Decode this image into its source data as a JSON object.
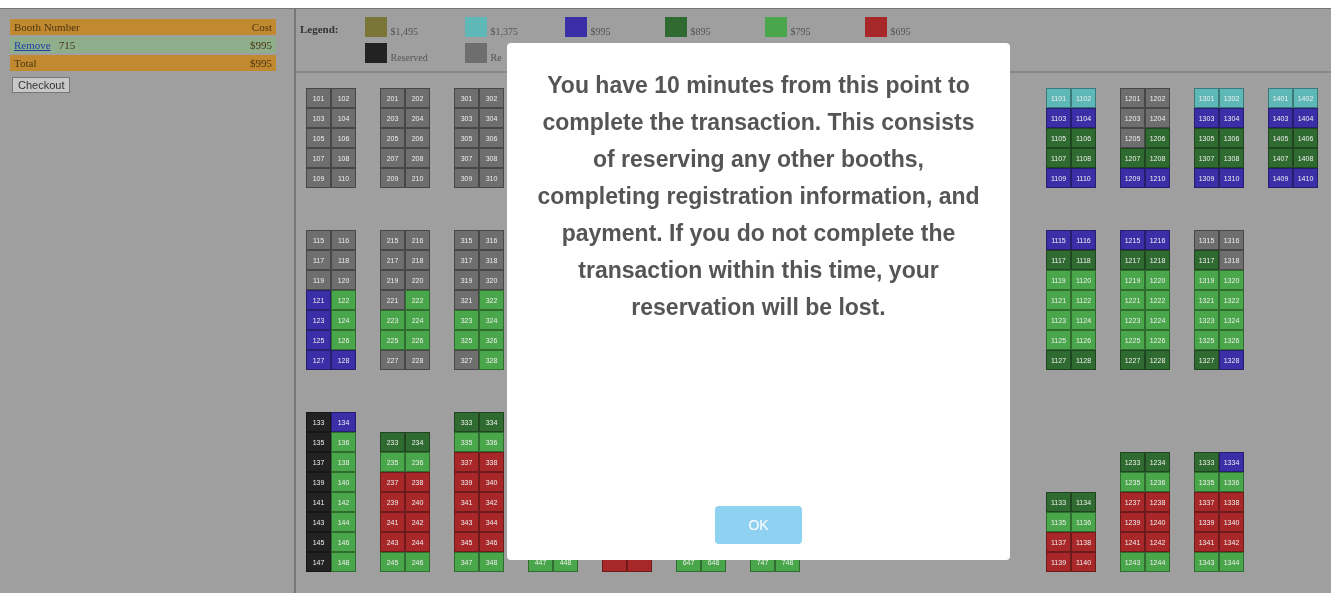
{
  "cart": {
    "columns": [
      "Booth Number",
      "Cost"
    ],
    "rows": [
      {
        "kind": "item",
        "link": "Remove",
        "booth": "715",
        "cost": "$995"
      },
      {
        "kind": "total",
        "booth": "Total",
        "cost": "$995"
      }
    ],
    "checkout": "Checkout"
  },
  "legend": {
    "label": "Legend:",
    "rows": [
      [
        {
          "color": "#7a7638",
          "text": "$1,495"
        },
        {
          "color": "#5fb8b8",
          "text": "$1,375"
        },
        {
          "color": "#3b2fa8",
          "text": "$995"
        },
        {
          "color": "#2f6b30",
          "text": "$895"
        },
        {
          "color": "#4aa64a",
          "text": "$795"
        },
        {
          "color": "#a8282a",
          "text": "$695"
        }
      ],
      [
        {
          "color": "#222222",
          "text": "Reserved"
        },
        {
          "color": "#6e6e6e",
          "text": "Re"
        }
      ]
    ]
  },
  "map": [
    {
      "left": [
        [
          [
            {
              "label": "101",
              "color": "#6e6e6e"
            },
            {
              "label": "102",
              "color": "#6e6e6e"
            }
          ],
          [
            {
              "label": "103",
              "color": "#6e6e6e"
            },
            {
              "label": "104",
              "color": "#6e6e6e"
            }
          ],
          [
            {
              "label": "105",
              "color": "#6e6e6e"
            },
            {
              "label": "106",
              "color": "#6e6e6e"
            }
          ],
          [
            {
              "label": "107",
              "color": "#6e6e6e"
            },
            {
              "label": "108",
              "color": "#6e6e6e"
            }
          ],
          [
            {
              "label": "109",
              "color": "#6e6e6e"
            },
            {
              "label": "110",
              "color": "#6e6e6e"
            }
          ]
        ],
        [
          [
            {
              "label": "201",
              "color": "#6e6e6e"
            },
            {
              "label": "202",
              "color": "#6e6e6e"
            }
          ],
          [
            {
              "label": "203",
              "color": "#6e6e6e"
            },
            {
              "label": "204",
              "color": "#6e6e6e"
            }
          ],
          [
            {
              "label": "205",
              "color": "#6e6e6e"
            },
            {
              "label": "206",
              "color": "#6e6e6e"
            }
          ],
          [
            {
              "label": "207",
              "color": "#6e6e6e"
            },
            {
              "label": "208",
              "color": "#6e6e6e"
            }
          ],
          [
            {
              "label": "209",
              "color": "#6e6e6e"
            },
            {
              "label": "210",
              "color": "#6e6e6e"
            }
          ]
        ],
        [
          [
            {
              "label": "301",
              "color": "#6e6e6e"
            },
            {
              "label": "302",
              "color": "#6e6e6e"
            }
          ],
          [
            {
              "label": "303",
              "color": "#6e6e6e"
            },
            {
              "label": "304",
              "color": "#6e6e6e"
            }
          ],
          [
            {
              "label": "305",
              "color": "#6e6e6e"
            },
            {
              "label": "306",
              "color": "#6e6e6e"
            }
          ],
          [
            {
              "label": "307",
              "color": "#6e6e6e"
            },
            {
              "label": "308",
              "color": "#6e6e6e"
            }
          ],
          [
            {
              "label": "309",
              "color": "#6e6e6e"
            },
            {
              "label": "310",
              "color": "#6e6e6e"
            }
          ]
        ]
      ],
      "right": [
        [
          [
            {
              "label": "1101",
              "color": "#5fb8b8"
            },
            {
              "label": "1102",
              "color": "#5fb8b8"
            }
          ],
          [
            {
              "label": "1103",
              "color": "#3b2fa8"
            },
            {
              "label": "1104",
              "color": "#3b2fa8"
            }
          ],
          [
            {
              "label": "1105",
              "color": "#2f6b30"
            },
            {
              "label": "1106",
              "color": "#2f6b30"
            }
          ],
          [
            {
              "label": "1107",
              "color": "#2f6b30"
            },
            {
              "label": "1108",
              "color": "#2f6b30"
            }
          ],
          [
            {
              "label": "1109",
              "color": "#3b2fa8"
            },
            {
              "label": "1110",
              "color": "#3b2fa8"
            }
          ]
        ],
        [
          [
            {
              "label": "1201",
              "color": "#6e6e6e"
            },
            {
              "label": "1202",
              "color": "#6e6e6e"
            }
          ],
          [
            {
              "label": "1203",
              "color": "#6e6e6e"
            },
            {
              "label": "1204",
              "color": "#6e6e6e"
            }
          ],
          [
            {
              "label": "1205",
              "color": "#6e6e6e"
            },
            {
              "label": "1206",
              "color": "#2f6b30"
            }
          ],
          [
            {
              "label": "1207",
              "color": "#2f6b30"
            },
            {
              "label": "1208",
              "color": "#2f6b30"
            }
          ],
          [
            {
              "label": "1209",
              "color": "#3b2fa8"
            },
            {
              "label": "1210",
              "color": "#3b2fa8"
            }
          ]
        ],
        [
          [
            {
              "label": "1301",
              "color": "#5fb8b8"
            },
            {
              "label": "1302",
              "color": "#5fb8b8"
            }
          ],
          [
            {
              "label": "1303",
              "color": "#3b2fa8"
            },
            {
              "label": "1304",
              "color": "#3b2fa8"
            }
          ],
          [
            {
              "label": "1305",
              "color": "#2f6b30"
            },
            {
              "label": "1306",
              "color": "#2f6b30"
            }
          ],
          [
            {
              "label": "1307",
              "color": "#2f6b30"
            },
            {
              "label": "1308",
              "color": "#2f6b30"
            }
          ],
          [
            {
              "label": "1309",
              "color": "#3b2fa8"
            },
            {
              "label": "1310",
              "color": "#3b2fa8"
            }
          ]
        ],
        [
          [
            {
              "label": "1401",
              "color": "#5fb8b8"
            },
            {
              "label": "1402",
              "color": "#5fb8b8"
            }
          ],
          [
            {
              "label": "1403",
              "color": "#3b2fa8"
            },
            {
              "label": "1404",
              "color": "#3b2fa8"
            }
          ],
          [
            {
              "label": "1405",
              "color": "#2f6b30"
            },
            {
              "label": "1406",
              "color": "#2f6b30"
            }
          ],
          [
            {
              "label": "1407",
              "color": "#2f6b30"
            },
            {
              "label": "1408",
              "color": "#2f6b30"
            }
          ],
          [
            {
              "label": "1409",
              "color": "#3b2fa8"
            },
            {
              "label": "1410",
              "color": "#3b2fa8"
            }
          ]
        ]
      ]
    },
    {
      "left": [
        [
          [
            {
              "label": "115",
              "color": "#6e6e6e"
            },
            {
              "label": "116",
              "color": "#6e6e6e"
            }
          ],
          [
            {
              "label": "117",
              "color": "#6e6e6e"
            },
            {
              "label": "118",
              "color": "#6e6e6e"
            }
          ],
          [
            {
              "label": "119",
              "color": "#6e6e6e"
            },
            {
              "label": "120",
              "color": "#6e6e6e"
            }
          ],
          [
            {
              "label": "121",
              "color": "#3b2fa8"
            },
            {
              "label": "122",
              "color": "#4aa64a"
            }
          ],
          [
            {
              "label": "123",
              "color": "#3b2fa8"
            },
            {
              "label": "124",
              "color": "#4aa64a"
            }
          ],
          [
            {
              "label": "125",
              "color": "#3b2fa8"
            },
            {
              "label": "126",
              "color": "#4aa64a"
            }
          ],
          [
            {
              "label": "127",
              "color": "#3b2fa8"
            },
            {
              "label": "128",
              "color": "#3b2fa8"
            }
          ]
        ],
        [
          [
            {
              "label": "215",
              "color": "#6e6e6e"
            },
            {
              "label": "216",
              "color": "#6e6e6e"
            }
          ],
          [
            {
              "label": "217",
              "color": "#6e6e6e"
            },
            {
              "label": "218",
              "color": "#6e6e6e"
            }
          ],
          [
            {
              "label": "219",
              "color": "#6e6e6e"
            },
            {
              "label": "220",
              "color": "#6e6e6e"
            }
          ],
          [
            {
              "label": "221",
              "color": "#6e6e6e"
            },
            {
              "label": "222",
              "color": "#4aa64a"
            }
          ],
          [
            {
              "label": "223",
              "color": "#4aa64a"
            },
            {
              "label": "224",
              "color": "#4aa64a"
            }
          ],
          [
            {
              "label": "225",
              "color": "#4aa64a"
            },
            {
              "label": "226",
              "color": "#4aa64a"
            }
          ],
          [
            {
              "label": "227",
              "color": "#6e6e6e"
            },
            {
              "label": "228",
              "color": "#6e6e6e"
            }
          ]
        ],
        [
          [
            {
              "label": "315",
              "color": "#6e6e6e"
            },
            {
              "label": "316",
              "color": "#6e6e6e"
            }
          ],
          [
            {
              "label": "317",
              "color": "#6e6e6e"
            },
            {
              "label": "318",
              "color": "#6e6e6e"
            }
          ],
          [
            {
              "label": "319",
              "color": "#6e6e6e"
            },
            {
              "label": "320",
              "color": "#6e6e6e"
            }
          ],
          [
            {
              "label": "321",
              "color": "#6e6e6e"
            },
            {
              "label": "322",
              "color": "#4aa64a"
            }
          ],
          [
            {
              "label": "323",
              "color": "#4aa64a"
            },
            {
              "label": "324",
              "color": "#4aa64a"
            }
          ],
          [
            {
              "label": "325",
              "color": "#4aa64a"
            },
            {
              "label": "326",
              "color": "#4aa64a"
            }
          ],
          [
            {
              "label": "327",
              "color": "#6e6e6e"
            },
            {
              "label": "328",
              "color": "#4aa64a"
            }
          ]
        ]
      ],
      "right": [
        [
          [
            {
              "label": "1115",
              "color": "#3b2fa8"
            },
            {
              "label": "1116",
              "color": "#3b2fa8"
            }
          ],
          [
            {
              "label": "1117",
              "color": "#2f6b30"
            },
            {
              "label": "1118",
              "color": "#2f6b30"
            }
          ],
          [
            {
              "label": "1119",
              "color": "#4aa64a"
            },
            {
              "label": "1120",
              "color": "#4aa64a"
            }
          ],
          [
            {
              "label": "1121",
              "color": "#4aa64a"
            },
            {
              "label": "1122",
              "color": "#4aa64a"
            }
          ],
          [
            {
              "label": "1123",
              "color": "#4aa64a"
            },
            {
              "label": "1124",
              "color": "#4aa64a"
            }
          ],
          [
            {
              "label": "1125",
              "color": "#4aa64a"
            },
            {
              "label": "1126",
              "color": "#4aa64a"
            }
          ],
          [
            {
              "label": "1127",
              "color": "#2f6b30"
            },
            {
              "label": "1128",
              "color": "#2f6b30"
            }
          ]
        ],
        [
          [
            {
              "label": "1215",
              "color": "#3b2fa8"
            },
            {
              "label": "1216",
              "color": "#3b2fa8"
            }
          ],
          [
            {
              "label": "1217",
              "color": "#2f6b30"
            },
            {
              "label": "1218",
              "color": "#2f6b30"
            }
          ],
          [
            {
              "label": "1219",
              "color": "#4aa64a"
            },
            {
              "label": "1220",
              "color": "#4aa64a"
            }
          ],
          [
            {
              "label": "1221",
              "color": "#4aa64a"
            },
            {
              "label": "1222",
              "color": "#4aa64a"
            }
          ],
          [
            {
              "label": "1223",
              "color": "#4aa64a"
            },
            {
              "label": "1224",
              "color": "#4aa64a"
            }
          ],
          [
            {
              "label": "1225",
              "color": "#4aa64a"
            },
            {
              "label": "1226",
              "color": "#4aa64a"
            }
          ],
          [
            {
              "label": "1227",
              "color": "#2f6b30"
            },
            {
              "label": "1228",
              "color": "#2f6b30"
            }
          ]
        ],
        [
          [
            {
              "label": "1315",
              "color": "#6e6e6e"
            },
            {
              "label": "1316",
              "color": "#6e6e6e"
            }
          ],
          [
            {
              "label": "1317",
              "color": "#2f6b30"
            },
            {
              "label": "1318",
              "color": "#6e6e6e"
            }
          ],
          [
            {
              "label": "1319",
              "color": "#4aa64a"
            },
            {
              "label": "1320",
              "color": "#4aa64a"
            }
          ],
          [
            {
              "label": "1321",
              "color": "#4aa64a"
            },
            {
              "label": "1322",
              "color": "#4aa64a"
            }
          ],
          [
            {
              "label": "1323",
              "color": "#4aa64a"
            },
            {
              "label": "1324",
              "color": "#4aa64a"
            }
          ],
          [
            {
              "label": "1325",
              "color": "#4aa64a"
            },
            {
              "label": "1326",
              "color": "#4aa64a"
            }
          ],
          [
            {
              "label": "1327",
              "color": "#2f6b30"
            },
            {
              "label": "1328",
              "color": "#3b2fa8"
            }
          ]
        ]
      ]
    },
    {
      "left": [
        [
          [
            {
              "label": "133",
              "color": "#222222"
            },
            {
              "label": "134",
              "color": "#3b2fa8"
            }
          ],
          [
            {
              "label": "135",
              "color": "#222222"
            },
            {
              "label": "136",
              "color": "#4aa64a"
            }
          ],
          [
            {
              "label": "137",
              "color": "#222222"
            },
            {
              "label": "138",
              "color": "#4aa64a"
            }
          ],
          [
            {
              "label": "139",
              "color": "#222222"
            },
            {
              "label": "140",
              "color": "#4aa64a"
            }
          ],
          [
            {
              "label": "141",
              "color": "#222222"
            },
            {
              "label": "142",
              "color": "#4aa64a"
            }
          ],
          [
            {
              "label": "143",
              "color": "#222222"
            },
            {
              "label": "144",
              "color": "#4aa64a"
            }
          ],
          [
            {
              "label": "145",
              "color": "#222222"
            },
            {
              "label": "146",
              "color": "#4aa64a"
            }
          ],
          [
            {
              "label": "147",
              "color": "#222222"
            },
            {
              "label": "148",
              "color": "#4aa64a"
            }
          ]
        ],
        [
          [
            {
              "label": "233",
              "color": "#2f6b30"
            },
            {
              "label": "234",
              "color": "#2f6b30"
            }
          ],
          [
            {
              "label": "235",
              "color": "#4aa64a"
            },
            {
              "label": "236",
              "color": "#4aa64a"
            }
          ],
          [
            {
              "label": "237",
              "color": "#a8282a"
            },
            {
              "label": "238",
              "color": "#a8282a"
            }
          ],
          [
            {
              "label": "239",
              "color": "#a8282a"
            },
            {
              "label": "240",
              "color": "#a8282a"
            }
          ],
          [
            {
              "label": "241",
              "color": "#a8282a"
            },
            {
              "label": "242",
              "color": "#a8282a"
            }
          ],
          [
            {
              "label": "243",
              "color": "#a8282a"
            },
            {
              "label": "244",
              "color": "#a8282a"
            }
          ],
          [
            {
              "label": "245",
              "color": "#4aa64a"
            },
            {
              "label": "246",
              "color": "#4aa64a"
            }
          ]
        ],
        [
          [
            {
              "label": "333",
              "color": "#2f6b30"
            },
            {
              "label": "334",
              "color": "#2f6b30"
            }
          ],
          [
            {
              "label": "335",
              "color": "#4aa64a"
            },
            {
              "label": "336",
              "color": "#4aa64a"
            }
          ],
          [
            {
              "label": "337",
              "color": "#a8282a"
            },
            {
              "label": "338",
              "color": "#a8282a"
            }
          ],
          [
            {
              "label": "339",
              "color": "#a8282a"
            },
            {
              "label": "340",
              "color": "#a8282a"
            }
          ],
          [
            {
              "label": "341",
              "color": "#a8282a"
            },
            {
              "label": "342",
              "color": "#a8282a"
            }
          ],
          [
            {
              "label": "343",
              "color": "#a8282a"
            },
            {
              "label": "344",
              "color": "#a8282a"
            }
          ],
          [
            {
              "label": "345",
              "color": "#a8282a"
            },
            {
              "label": "346",
              "color": "#a8282a"
            }
          ],
          [
            {
              "label": "347",
              "color": "#4aa64a"
            },
            {
              "label": "348",
              "color": "#4aa64a"
            }
          ]
        ],
        [
          [
            {
              "label": "447",
              "color": "#4aa64a"
            },
            {
              "label": "448",
              "color": "#4aa64a"
            }
          ]
        ],
        [
          [
            {
              "color": "#a8282a"
            },
            {
              "color": "#a8282a"
            }
          ]
        ],
        [
          [
            {
              "label": "647",
              "color": "#4aa64a"
            },
            {
              "label": "648",
              "color": "#4aa64a"
            }
          ]
        ],
        [
          [
            {
              "label": "747",
              "color": "#4aa64a"
            },
            {
              "label": "748",
              "color": "#4aa64a"
            }
          ]
        ]
      ],
      "right": [
        [
          [
            {
              "label": "1133",
              "color": "#2f6b30"
            },
            {
              "label": "1134",
              "color": "#2f6b30"
            }
          ],
          [
            {
              "label": "1135",
              "color": "#4aa64a"
            },
            {
              "label": "1136",
              "color": "#4aa64a"
            }
          ],
          [
            {
              "label": "1137",
              "color": "#a8282a"
            },
            {
              "label": "1138",
              "color": "#a8282a"
            }
          ],
          [
            {
              "label": "1139",
              "color": "#a8282a"
            },
            {
              "label": "1140",
              "color": "#a8282a"
            }
          ]
        ],
        [
          [
            {
              "label": "1233",
              "color": "#2f6b30"
            },
            {
              "label": "1234",
              "color": "#2f6b30"
            }
          ],
          [
            {
              "label": "1235",
              "color": "#4aa64a"
            },
            {
              "label": "1236",
              "color": "#4aa64a"
            }
          ],
          [
            {
              "label": "1237",
              "color": "#a8282a"
            },
            {
              "label": "1238",
              "color": "#a8282a"
            }
          ],
          [
            {
              "label": "1239",
              "color": "#a8282a"
            },
            {
              "label": "1240",
              "color": "#a8282a"
            }
          ],
          [
            {
              "label": "1241",
              "color": "#a8282a"
            },
            {
              "label": "1242",
              "color": "#a8282a"
            }
          ],
          [
            {
              "label": "1243",
              "color": "#4aa64a"
            },
            {
              "label": "1244",
              "color": "#4aa64a"
            }
          ]
        ],
        [
          [
            {
              "label": "1333",
              "color": "#2f6b30"
            },
            {
              "label": "1334",
              "color": "#3b2fa8"
            }
          ],
          [
            {
              "label": "1335",
              "color": "#4aa64a"
            },
            {
              "label": "1336",
              "color": "#4aa64a"
            }
          ],
          [
            {
              "label": "1337",
              "color": "#a8282a"
            },
            {
              "label": "1338",
              "color": "#a8282a"
            }
          ],
          [
            {
              "label": "1339",
              "color": "#a8282a"
            },
            {
              "label": "1340",
              "color": "#a8282a"
            }
          ],
          [
            {
              "label": "1341",
              "color": "#a8282a"
            },
            {
              "label": "1342",
              "color": "#a8282a"
            }
          ],
          [
            {
              "label": "1343",
              "color": "#4aa64a"
            },
            {
              "label": "1344",
              "color": "#4aa64a"
            }
          ]
        ]
      ]
    }
  ],
  "dialog": {
    "message": "You have 10 minutes from this point to complete the transaction. This consists of reserving any other booths, completing registration information, and payment. If you do not complete the transaction within this time, your reservation will be lost.",
    "button": "OK"
  }
}
